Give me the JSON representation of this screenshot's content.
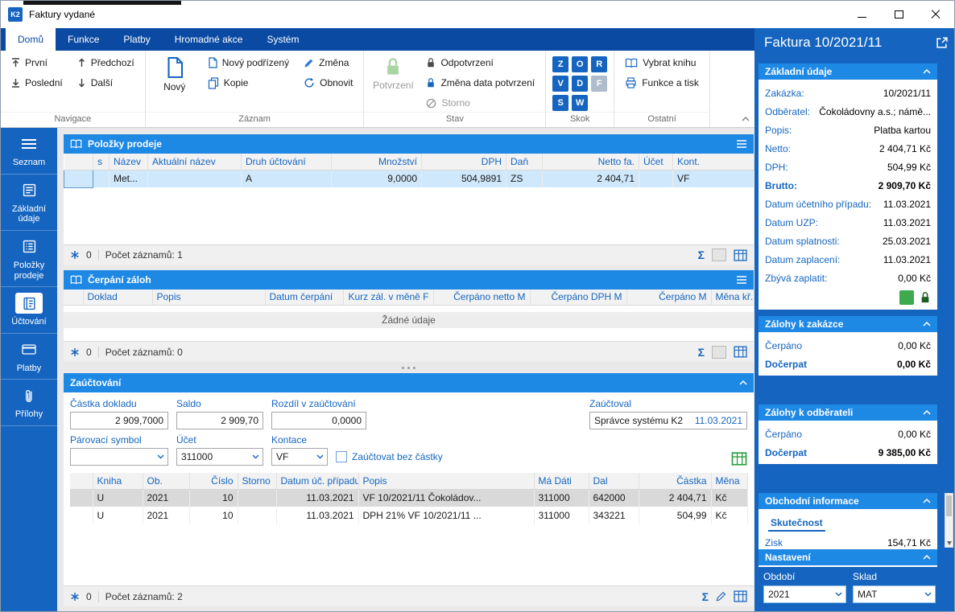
{
  "window": {
    "title": "Faktury vydané",
    "logo": "K2"
  },
  "icons": {
    "sigma": "Σ"
  },
  "menu": {
    "tabs": [
      {
        "label": "Domů"
      },
      {
        "label": "Funkce"
      },
      {
        "label": "Platby"
      },
      {
        "label": "Hromadné akce"
      },
      {
        "label": "Systém"
      }
    ]
  },
  "ribbon": {
    "navigace": {
      "label": "Navigace",
      "prvni": "První",
      "posledni": "Poslední",
      "predchozi": "Předchozí",
      "dalsi": "Další"
    },
    "zaznam": {
      "label": "Záznam",
      "novy": "Nový",
      "novy_podrizeny": "Nový podřízený",
      "kopie": "Kopie",
      "zmena": "Změna",
      "obnovit": "Obnovit"
    },
    "stav": {
      "label": "Stav",
      "potvrzeni": "Potvrzení",
      "odpotvrzeni": "Odpotvrzení",
      "zmena_data": "Změna data potvrzení",
      "storno": "Storno"
    },
    "skok": {
      "label": "Skok",
      "keys": [
        "Z",
        "O",
        "R",
        "V",
        "D",
        "F",
        "S",
        "W"
      ]
    },
    "ostatni": {
      "label": "Ostatní",
      "vybrat_knihu": "Vybrat knihu",
      "funkce_tisk": "Funkce a tisk"
    }
  },
  "sidebar": {
    "items": [
      {
        "label": "Seznam"
      },
      {
        "label": "Základní údaje"
      },
      {
        "label": "Položky prodeje"
      },
      {
        "label": "Účtování"
      },
      {
        "label": "Platby"
      },
      {
        "label": "Přílohy"
      }
    ]
  },
  "polozky": {
    "title": "Položky prodeje",
    "columns": [
      "s",
      "Název",
      "Aktuální název",
      "Druh účtování",
      "Množství",
      "DPH",
      "Daň",
      "Netto fa.",
      "Účet",
      "Kont."
    ],
    "row": {
      "nazev": "Met...",
      "druh": "A",
      "mnozstvi": "9,0000",
      "dph": "504,9891",
      "dan": "ZS",
      "netto": "2 404,71",
      "ucet": "",
      "kont": "VF"
    },
    "footer": {
      "filter_count": "0",
      "count": "Počet záznamů: 1"
    }
  },
  "cerpani": {
    "title": "Čerpání záloh",
    "columns": [
      "Doklad",
      "Popis",
      "Datum čerpání",
      "Kurz zál. v měně F",
      "Čerpáno netto M",
      "Čerpáno DPH M",
      "Čerpáno M",
      "Měna kř."
    ],
    "empty": "Žádné údaje",
    "footer": {
      "filter_count": "0",
      "count": "Počet záznamů: 0"
    }
  },
  "zauctovani": {
    "title": "Zaúčtování",
    "form": {
      "castka_label": "Částka dokladu",
      "castka": "2 909,7000",
      "saldo_label": "Saldo",
      "saldo": "2 909,70",
      "rozdil_label": "Rozdíl v zaúčtování",
      "rozdil": "0,0000",
      "zauctoval_label": "Zaúčtoval",
      "zauctoval_name": "Správce systému K2",
      "zauctoval_datum": "11.03.2021",
      "parovaci_label": "Párovací symbol",
      "parovaci": "",
      "ucet_label": "Účet",
      "ucet": "311000",
      "kontace_label": "Kontace",
      "kontace": "VF",
      "checkbox_label": "Zaúčtovat bez částky"
    },
    "columns": [
      "Kniha",
      "Ob.",
      "Číslo",
      "Storno",
      "Datum úč. případu",
      "Popis",
      "Má Dáti",
      "Dal",
      "Částka",
      "Měna"
    ],
    "rows": [
      {
        "kniha": "U",
        "ob": "2021",
        "cislo": "10",
        "storno": "",
        "datum": "11.03.2021",
        "popis": "VF 10/2021/11 Čokoládov...",
        "ma_dati": "311000",
        "dal": "642000",
        "castka": "2 404,71",
        "mena": "Kč"
      },
      {
        "kniha": "U",
        "ob": "2021",
        "cislo": "10",
        "storno": "",
        "datum": "11.03.2021",
        "popis": "DPH 21% VF 10/2021/11 ...",
        "ma_dati": "311000",
        "dal": "343221",
        "castka": "504,99",
        "mena": "Kč"
      }
    ],
    "footer": {
      "filter_count": "0",
      "count": "Počet záznamů: 2"
    }
  },
  "detail": {
    "title": "Faktura 10/2021/11",
    "zakladni": {
      "title": "Základní údaje",
      "rows": [
        {
          "label": "Zakázka:",
          "value": "10/2021/11"
        },
        {
          "label": "Odběratel:",
          "value": "Čokoládovny a.s.; námě..."
        },
        {
          "label": "Popis:",
          "value": "Platba kartou"
        },
        {
          "label": "Netto:",
          "value": "2 404,71 Kč"
        },
        {
          "label": "DPH:",
          "value": "504,99 Kč"
        },
        {
          "label": "Brutto:",
          "value": "2 909,70 Kč"
        },
        {
          "label": "Datum účetního případu:",
          "value": "11.03.2021"
        },
        {
          "label": "Datum UZP:",
          "value": "11.03.2021"
        },
        {
          "label": "Datum splatnosti:",
          "value": "25.03.2021"
        },
        {
          "label": "Datum zaplacení:",
          "value": "11.03.2021"
        },
        {
          "label": "Zbývá zaplatit:",
          "value": "0,00 Kč"
        }
      ]
    },
    "zalohy_zakazce": {
      "title": "Zálohy k zakázce",
      "cerpano_label": "Čerpáno",
      "cerpano": "0,00 Kč",
      "docerpat_label": "Dočerpat",
      "docerpat": "0,00 Kč"
    },
    "zalohy_odberateli": {
      "title": "Zálohy k odběrateli",
      "cerpano_label": "Čerpáno",
      "cerpano": "0,00 Kč",
      "docerpat_label": "Dočerpat",
      "docerpat": "9 385,00 Kč"
    },
    "obchodni": {
      "title": "Obchodní informace",
      "tab": "Skutečnost",
      "zisk_label": "Zisk",
      "zisk": "154,71 Kč"
    },
    "nastaveni": {
      "title": "Nastavení",
      "obdobi_label": "Období",
      "obdobi": "2021",
      "sklad_label": "Sklad",
      "sklad": "MAT"
    }
  }
}
